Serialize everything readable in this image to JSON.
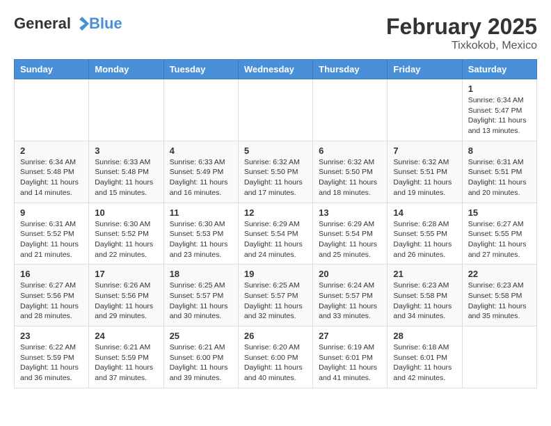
{
  "header": {
    "logo_general": "General",
    "logo_blue": "Blue",
    "month_year": "February 2025",
    "location": "Tixkokob, Mexico"
  },
  "days_of_week": [
    "Sunday",
    "Monday",
    "Tuesday",
    "Wednesday",
    "Thursday",
    "Friday",
    "Saturday"
  ],
  "weeks": [
    [
      {
        "num": "",
        "info": ""
      },
      {
        "num": "",
        "info": ""
      },
      {
        "num": "",
        "info": ""
      },
      {
        "num": "",
        "info": ""
      },
      {
        "num": "",
        "info": ""
      },
      {
        "num": "",
        "info": ""
      },
      {
        "num": "1",
        "info": "Sunrise: 6:34 AM\nSunset: 5:47 PM\nDaylight: 11 hours and 13 minutes."
      }
    ],
    [
      {
        "num": "2",
        "info": "Sunrise: 6:34 AM\nSunset: 5:48 PM\nDaylight: 11 hours and 14 minutes."
      },
      {
        "num": "3",
        "info": "Sunrise: 6:33 AM\nSunset: 5:48 PM\nDaylight: 11 hours and 15 minutes."
      },
      {
        "num": "4",
        "info": "Sunrise: 6:33 AM\nSunset: 5:49 PM\nDaylight: 11 hours and 16 minutes."
      },
      {
        "num": "5",
        "info": "Sunrise: 6:32 AM\nSunset: 5:50 PM\nDaylight: 11 hours and 17 minutes."
      },
      {
        "num": "6",
        "info": "Sunrise: 6:32 AM\nSunset: 5:50 PM\nDaylight: 11 hours and 18 minutes."
      },
      {
        "num": "7",
        "info": "Sunrise: 6:32 AM\nSunset: 5:51 PM\nDaylight: 11 hours and 19 minutes."
      },
      {
        "num": "8",
        "info": "Sunrise: 6:31 AM\nSunset: 5:51 PM\nDaylight: 11 hours and 20 minutes."
      }
    ],
    [
      {
        "num": "9",
        "info": "Sunrise: 6:31 AM\nSunset: 5:52 PM\nDaylight: 11 hours and 21 minutes."
      },
      {
        "num": "10",
        "info": "Sunrise: 6:30 AM\nSunset: 5:52 PM\nDaylight: 11 hours and 22 minutes."
      },
      {
        "num": "11",
        "info": "Sunrise: 6:30 AM\nSunset: 5:53 PM\nDaylight: 11 hours and 23 minutes."
      },
      {
        "num": "12",
        "info": "Sunrise: 6:29 AM\nSunset: 5:54 PM\nDaylight: 11 hours and 24 minutes."
      },
      {
        "num": "13",
        "info": "Sunrise: 6:29 AM\nSunset: 5:54 PM\nDaylight: 11 hours and 25 minutes."
      },
      {
        "num": "14",
        "info": "Sunrise: 6:28 AM\nSunset: 5:55 PM\nDaylight: 11 hours and 26 minutes."
      },
      {
        "num": "15",
        "info": "Sunrise: 6:27 AM\nSunset: 5:55 PM\nDaylight: 11 hours and 27 minutes."
      }
    ],
    [
      {
        "num": "16",
        "info": "Sunrise: 6:27 AM\nSunset: 5:56 PM\nDaylight: 11 hours and 28 minutes."
      },
      {
        "num": "17",
        "info": "Sunrise: 6:26 AM\nSunset: 5:56 PM\nDaylight: 11 hours and 29 minutes."
      },
      {
        "num": "18",
        "info": "Sunrise: 6:25 AM\nSunset: 5:57 PM\nDaylight: 11 hours and 30 minutes."
      },
      {
        "num": "19",
        "info": "Sunrise: 6:25 AM\nSunset: 5:57 PM\nDaylight: 11 hours and 32 minutes."
      },
      {
        "num": "20",
        "info": "Sunrise: 6:24 AM\nSunset: 5:57 PM\nDaylight: 11 hours and 33 minutes."
      },
      {
        "num": "21",
        "info": "Sunrise: 6:23 AM\nSunset: 5:58 PM\nDaylight: 11 hours and 34 minutes."
      },
      {
        "num": "22",
        "info": "Sunrise: 6:23 AM\nSunset: 5:58 PM\nDaylight: 11 hours and 35 minutes."
      }
    ],
    [
      {
        "num": "23",
        "info": "Sunrise: 6:22 AM\nSunset: 5:59 PM\nDaylight: 11 hours and 36 minutes."
      },
      {
        "num": "24",
        "info": "Sunrise: 6:21 AM\nSunset: 5:59 PM\nDaylight: 11 hours and 37 minutes."
      },
      {
        "num": "25",
        "info": "Sunrise: 6:21 AM\nSunset: 6:00 PM\nDaylight: 11 hours and 39 minutes."
      },
      {
        "num": "26",
        "info": "Sunrise: 6:20 AM\nSunset: 6:00 PM\nDaylight: 11 hours and 40 minutes."
      },
      {
        "num": "27",
        "info": "Sunrise: 6:19 AM\nSunset: 6:01 PM\nDaylight: 11 hours and 41 minutes."
      },
      {
        "num": "28",
        "info": "Sunrise: 6:18 AM\nSunset: 6:01 PM\nDaylight: 11 hours and 42 minutes."
      },
      {
        "num": "",
        "info": ""
      }
    ]
  ]
}
